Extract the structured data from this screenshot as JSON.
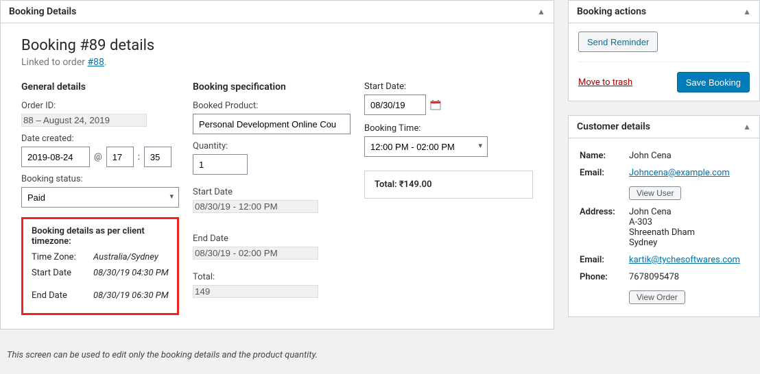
{
  "main": {
    "panel_title": "Booking Details",
    "heading": "Booking #89 details",
    "linked_prefix": "Linked to order ",
    "linked_order": "#88",
    "linked_suffix": ".",
    "general": {
      "title": "General details",
      "order_id_label": "Order ID:",
      "order_id": "88 – August 24, 2019",
      "date_created_label": "Date created:",
      "date_created": "2019-08-24",
      "at": "@",
      "hour": "17",
      "colon": ":",
      "minute": "35",
      "status_label": "Booking status:",
      "status": "Paid"
    },
    "client_tz": {
      "title": "Booking details as per client timezone:",
      "tz_label": "Time Zone:",
      "tz": "Australia/Sydney",
      "start_label": "Start Date",
      "start": "08/30/19 04:30 PM",
      "end_label": "End Date",
      "end": "08/30/19 06:30 PM"
    },
    "spec": {
      "title": "Booking specification",
      "product_label": "Booked Product:",
      "product": "Personal Development Online Cou",
      "quantity_label": "Quantity:",
      "quantity": "1",
      "start_label": "Start Date",
      "start": "08/30/19 - 12:00 PM",
      "end_label": "End Date",
      "end": "08/30/19 - 02:00 PM",
      "total_label": "Total:",
      "total": "149"
    },
    "right": {
      "start_date_label": "Start Date:",
      "start_date": "08/30/19",
      "time_label": "Booking Time:",
      "time": "12:00 PM - 02:00 PM",
      "total_label": "Total: ",
      "total_value": "₹149.00"
    },
    "note": "This screen can be used to edit only the booking details and the product quantity."
  },
  "actions": {
    "panel_title": "Booking actions",
    "send_reminder": "Send Reminder",
    "move_to_trash": "Move to trash",
    "save": "Save Booking"
  },
  "customer": {
    "panel_title": "Customer details",
    "name_label": "Name:",
    "name": "John Cena",
    "email_label": "Email:",
    "email": "Johncena@example.com",
    "view_user": "View User",
    "address_label": "Address:",
    "address_line1": "John Cena",
    "address_line2": "A-303",
    "address_line3": "Shreenath Dham",
    "address_line4": "Sydney",
    "email2_label": "Email:",
    "email2": "kartik@tychesoftwares.com",
    "phone_label": "Phone:",
    "phone": "7678095478",
    "view_order": "View Order"
  },
  "colors": {
    "accent": "#007cba",
    "link": "#0073aa",
    "danger": "#a00",
    "highlight_border": "#e22"
  }
}
